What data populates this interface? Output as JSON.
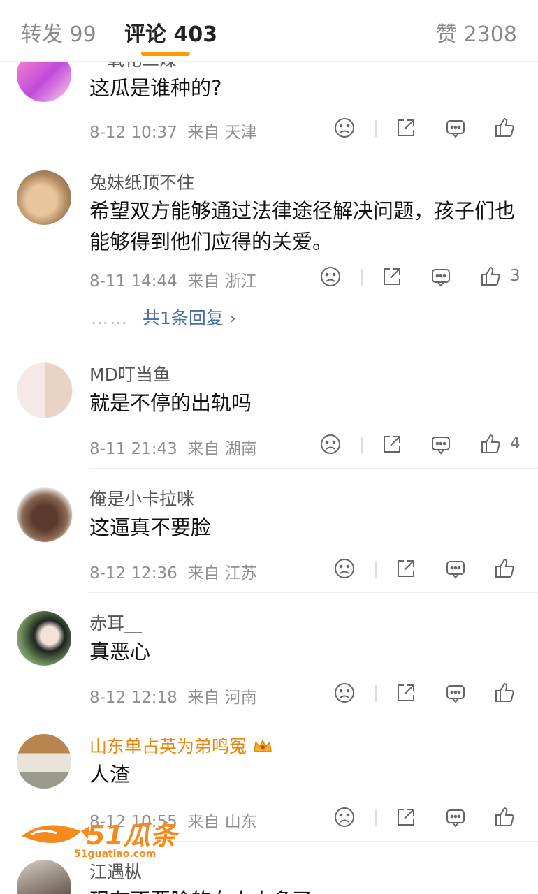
{
  "tabs": {
    "forward": {
      "label": "转发 99"
    },
    "comments": {
      "label": "评论 403"
    },
    "likes": {
      "label": "赞 2308"
    }
  },
  "comments": [
    {
      "username": "一氧化二煤",
      "text": "这瓜是谁种的?",
      "time": "8-12 10:37",
      "source": "来自 天津",
      "likes": ""
    },
    {
      "username": "兔妹纸顶不住",
      "text": "希望双方能够通过法律途径解决问题，孩子们也能够得到他们应得的关爱。",
      "time": "8-11 14:44",
      "source": "来自 浙江",
      "likes": "3",
      "replies": "共1条回复"
    },
    {
      "username": "MD叮当鱼",
      "text": "就是不停的出轨吗",
      "time": "8-11 21:43",
      "source": "来自 湖南",
      "likes": "4"
    },
    {
      "username": "俺是小卡拉咪",
      "text": "这逼真不要脸",
      "time": "8-12 12:36",
      "source": "来自 江苏",
      "likes": ""
    },
    {
      "username": "赤耳__",
      "text": "真恶心",
      "time": "8-12 12:18",
      "source": "来自 河南",
      "likes": ""
    },
    {
      "username": "山东单占英为弟鸣冤",
      "text": "人渣",
      "time": "8-12 10:55",
      "source": "来自 山东",
      "likes": ""
    },
    {
      "username": "江遇枞",
      "text": "现在不要脸的女人太多了",
      "time": "",
      "source": "",
      "likes": ""
    }
  ],
  "watermark": {
    "brand": "51瓜条",
    "url": "51guatiao.com"
  },
  "colors": {
    "accent": "#ff9a00",
    "vip_name": "#e8870e",
    "reply_link": "#4a6fa5"
  }
}
